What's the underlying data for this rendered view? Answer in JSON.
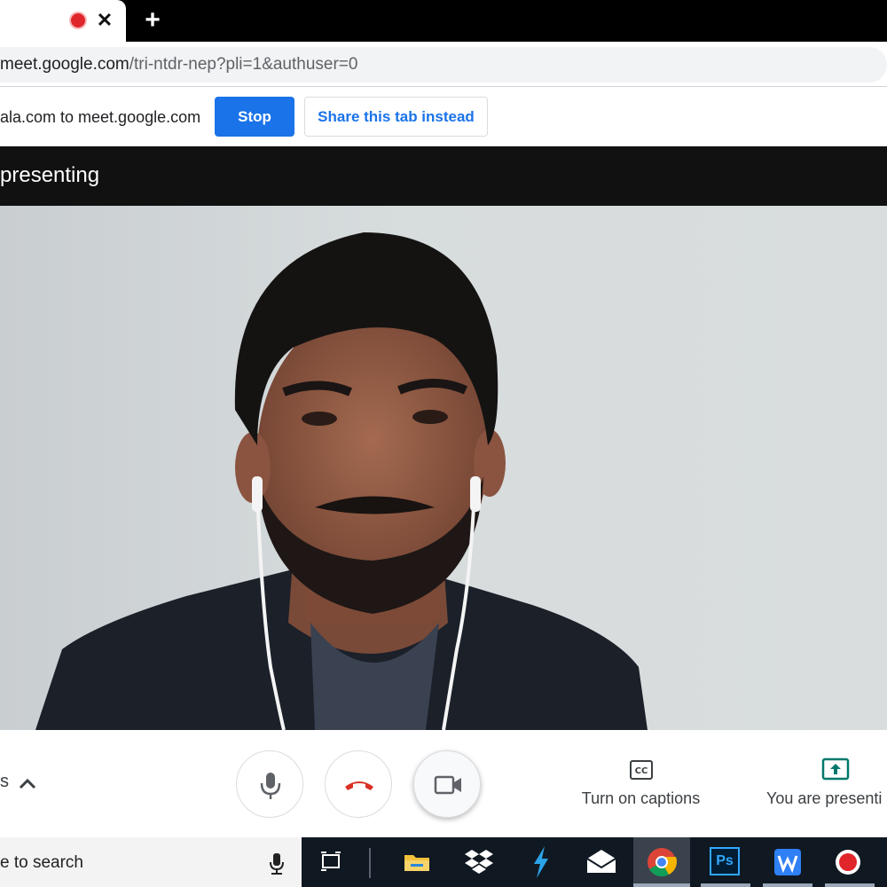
{
  "browser": {
    "tab_close": "✕",
    "new_tab": "+",
    "url_host": "meet.google.com",
    "url_path": "/tri-ntdr-nep?pli=1&authuser=0"
  },
  "share_bar": {
    "message": "ala.com to meet.google.com",
    "stop_label": "Stop",
    "share_tab_label": "Share this tab instead"
  },
  "meet": {
    "presenting_banner": "presenting",
    "left_control_text": "s",
    "captions_label": "Turn on captions",
    "presenting_label": "You are presenti"
  },
  "taskbar": {
    "search_text": "e to search",
    "ps_label": "Ps"
  },
  "colors": {
    "accent": "#1a73e8",
    "end_call": "#d93025",
    "present_green": "#00796b",
    "record": "#e0262b"
  }
}
